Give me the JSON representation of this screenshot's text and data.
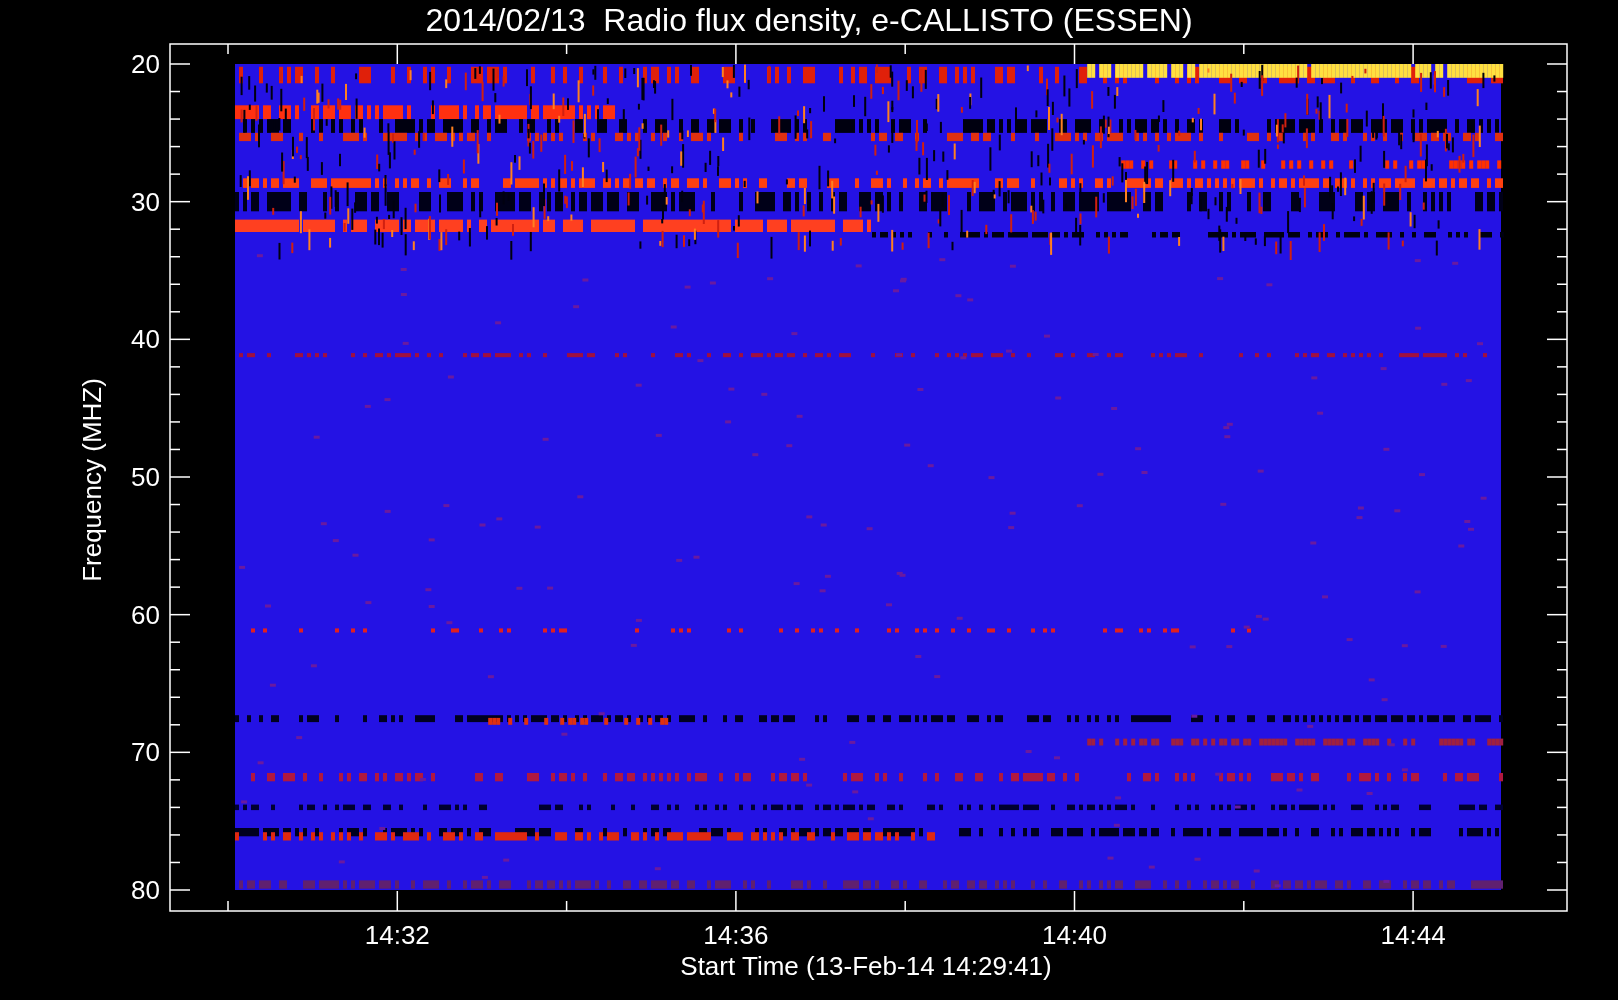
{
  "title": "2014/02/13  Radio flux density, e-CALLISTO (ESSEN)",
  "y_axis": {
    "label": "Frequency (MHZ)",
    "ticks": [
      "20",
      "30",
      "40",
      "50",
      "60",
      "70",
      "80"
    ]
  },
  "x_axis": {
    "label": "Start Time (13-Feb-14 14:29:41)",
    "ticks": [
      "14:32",
      "14:36",
      "14:40",
      "14:44"
    ]
  }
}
